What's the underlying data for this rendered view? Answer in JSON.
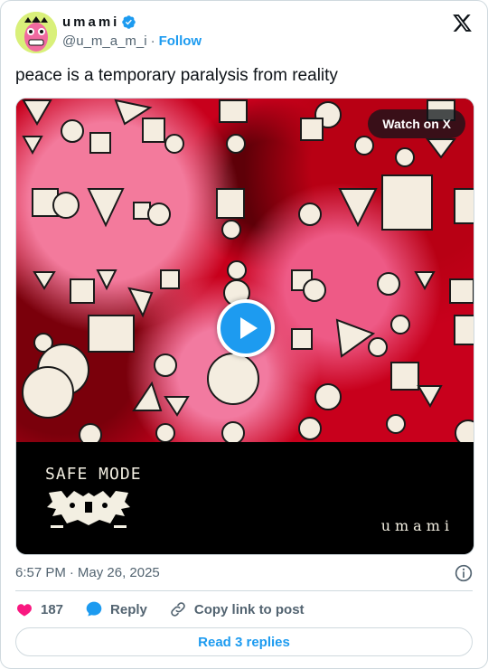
{
  "author": {
    "display_name": "umami",
    "handle": "@u_m_a_m_i",
    "separator": "·",
    "follow_label": "Follow",
    "verified": true,
    "avatar_bg": "#d9f07a"
  },
  "tweet": {
    "text": "peace is a temporary paralysis from reality",
    "time": "6:57 PM",
    "separator": "·",
    "date": "May 26, 2025"
  },
  "media": {
    "watch_label": "Watch on X",
    "banner_left_text": "SAFE MODE",
    "banner_right_text": "umami",
    "play_icon": "play-icon"
  },
  "actions": {
    "like_count": "187",
    "reply_label": "Reply",
    "copy_label": "Copy link to post"
  },
  "footer": {
    "read_replies_label": "Read 3 replies"
  },
  "colors": {
    "accent": "#1d9bf0",
    "like": "#f91880",
    "muted": "#536471",
    "artwork_base": "#c8001c"
  }
}
